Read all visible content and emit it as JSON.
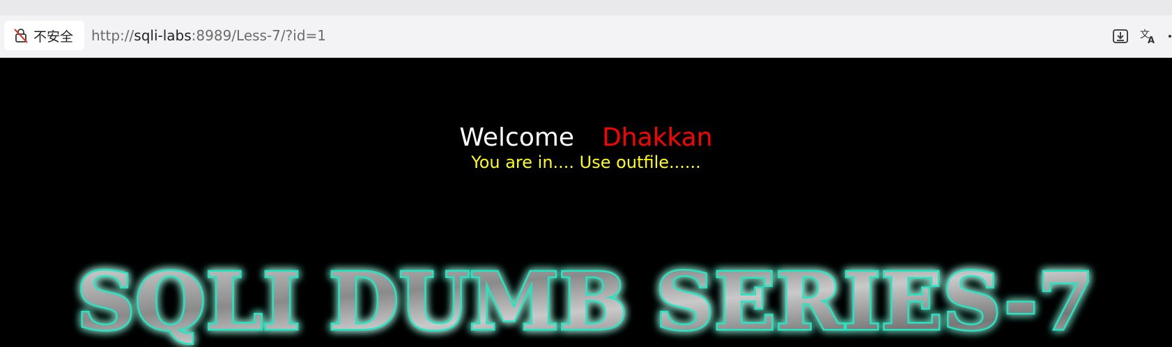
{
  "browser": {
    "security_label": "不安全",
    "url": {
      "scheme": "http://",
      "host": "sqli-labs",
      "rest": ":8989/Less-7/?id=1"
    },
    "icons": [
      "not-secure-icon",
      "download-icon",
      "translate-icon",
      "more-icon"
    ]
  },
  "page": {
    "welcome": "Welcome",
    "name": "Dhakkan",
    "status": "You are in.... Use outfile......",
    "banner": "SQLI DUMB SERIES-7",
    "colors": {
      "background": "#000000",
      "welcome": "#ffffff",
      "name": "#ff0000",
      "status": "#ffff00",
      "banner_glow": "#21e6c1"
    }
  }
}
